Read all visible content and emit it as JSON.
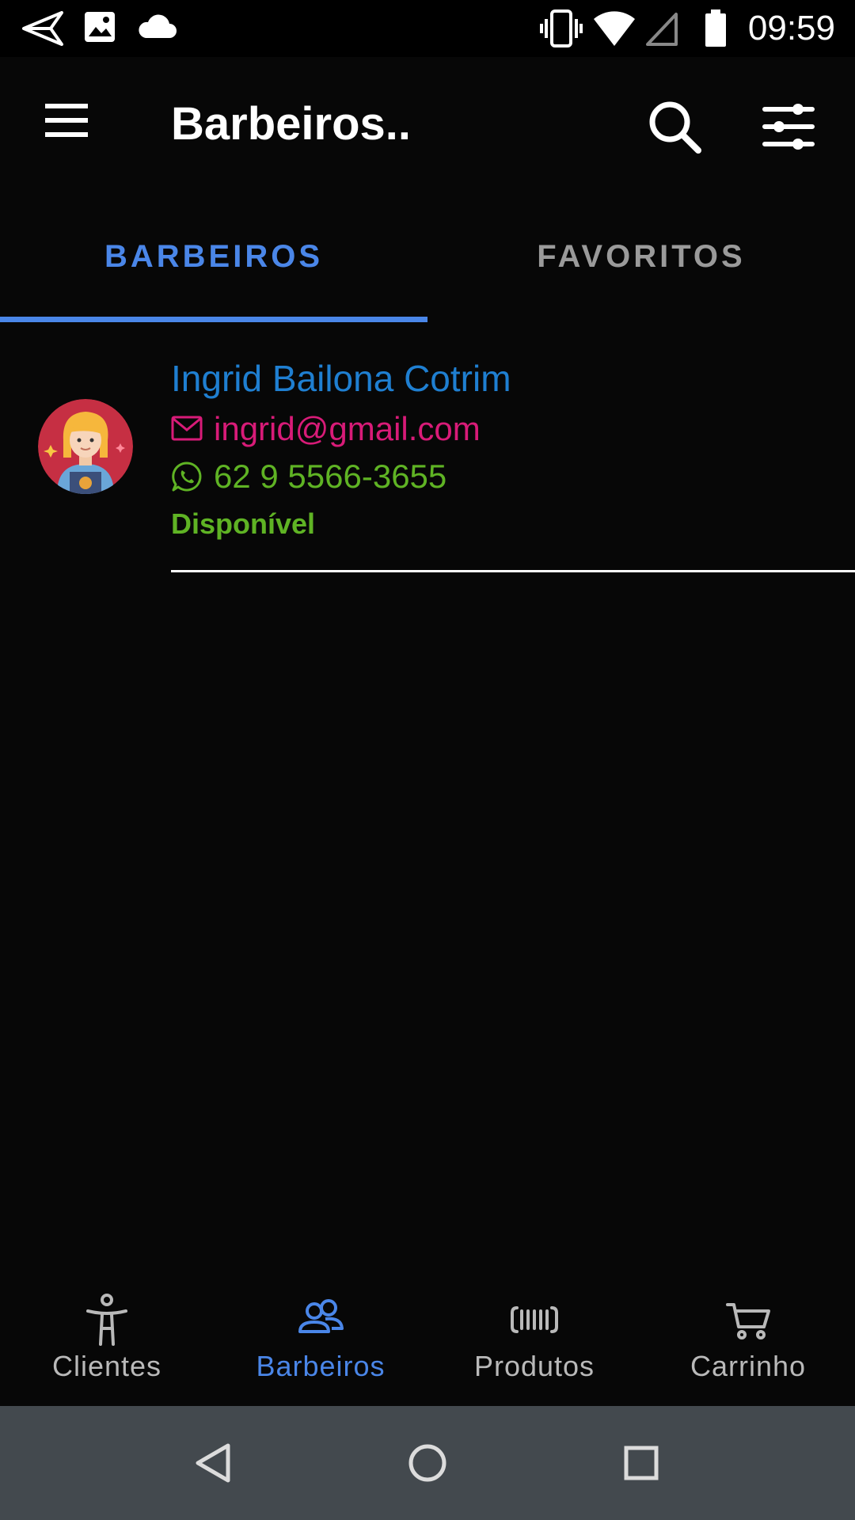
{
  "status_bar": {
    "time": "09:59",
    "icons": [
      "send-icon",
      "image-icon",
      "cloud-icon",
      "vibrate-icon",
      "wifi-icon",
      "signal-icon",
      "battery-icon"
    ]
  },
  "app_bar": {
    "title": "Barbeiros..",
    "icons": [
      "menu-icon",
      "search-icon",
      "filter-icon"
    ]
  },
  "tabs": [
    {
      "label": "BARBEIROS",
      "active": true
    },
    {
      "label": "FAVORITOS",
      "active": false
    }
  ],
  "barbers": [
    {
      "name": "Ingrid Bailona Cotrim",
      "email": "ingrid@gmail.com",
      "phone": "62 9 5566-3655",
      "status": "Disponível"
    }
  ],
  "bottom_nav": [
    {
      "label": "Clientes",
      "icon": "person-icon",
      "active": false
    },
    {
      "label": "Barbeiros",
      "icon": "people-icon",
      "active": true
    },
    {
      "label": "Produtos",
      "icon": "barcode-icon",
      "active": false
    },
    {
      "label": "Carrinho",
      "icon": "cart-icon",
      "active": false
    }
  ],
  "system_nav": [
    "back-icon",
    "home-icon",
    "recents-icon"
  ],
  "colors": {
    "accent": "#4a86e8",
    "name": "#1f7fd1",
    "email": "#d81b78",
    "phone": "#5fb324",
    "background": "#070707"
  }
}
